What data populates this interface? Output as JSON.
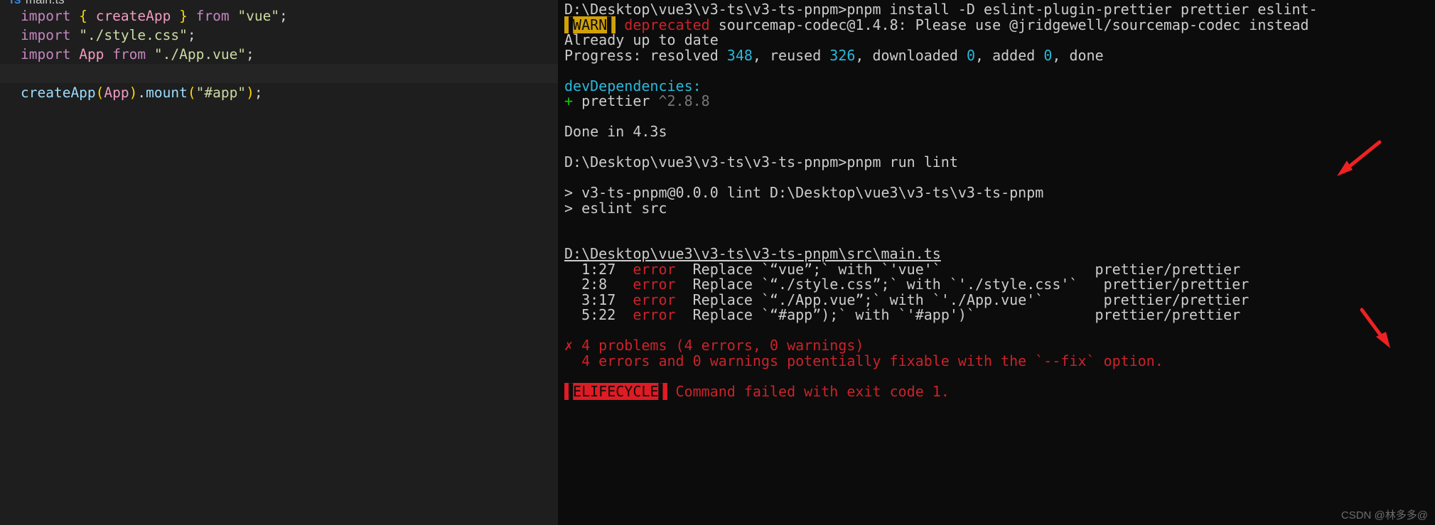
{
  "editor": {
    "tab": {
      "label": "main.ts",
      "icon": "TS",
      "file_type_icon": "typescript-file-icon"
    },
    "code_lines": [
      {
        "tokens": [
          {
            "t": "import",
            "c": "kw-import"
          },
          {
            "t": " ",
            "c": "plain"
          },
          {
            "t": "{",
            "c": "kw-brace"
          },
          {
            "t": " ",
            "c": "plain"
          },
          {
            "t": "createApp",
            "c": "ident-pink"
          },
          {
            "t": " ",
            "c": "plain"
          },
          {
            "t": "}",
            "c": "kw-brace"
          },
          {
            "t": " ",
            "c": "plain"
          },
          {
            "t": "from",
            "c": "kw-import"
          },
          {
            "t": " ",
            "c": "plain"
          },
          {
            "t": "\"vue\"",
            "c": "str"
          },
          {
            "t": ";",
            "c": "punct"
          }
        ]
      },
      {
        "tokens": [
          {
            "t": "import",
            "c": "kw-import"
          },
          {
            "t": " ",
            "c": "plain"
          },
          {
            "t": "\"./style.css\"",
            "c": "str"
          },
          {
            "t": ";",
            "c": "punct"
          }
        ]
      },
      {
        "tokens": [
          {
            "t": "import",
            "c": "kw-import"
          },
          {
            "t": " ",
            "c": "plain"
          },
          {
            "t": "App",
            "c": "ident-pink"
          },
          {
            "t": " ",
            "c": "plain"
          },
          {
            "t": "from",
            "c": "kw-import"
          },
          {
            "t": " ",
            "c": "plain"
          },
          {
            "t": "\"./App.vue\"",
            "c": "str"
          },
          {
            "t": ";",
            "c": "punct"
          }
        ]
      },
      {
        "highlight": true,
        "tokens": []
      },
      {
        "tokens": [
          {
            "t": "createApp",
            "c": "ident-call"
          },
          {
            "t": "(",
            "c": "kw-brace"
          },
          {
            "t": "App",
            "c": "ident-pink"
          },
          {
            "t": ")",
            "c": "kw-brace"
          },
          {
            "t": ".",
            "c": "punct"
          },
          {
            "t": "mount",
            "c": "ident-call"
          },
          {
            "t": "(",
            "c": "kw-brace"
          },
          {
            "t": "\"#app\"",
            "c": "str"
          },
          {
            "t": ")",
            "c": "kw-brace"
          },
          {
            "t": ";",
            "c": "punct"
          }
        ]
      }
    ]
  },
  "terminal": {
    "lines": [
      {
        "segs": [
          {
            "t": "D:\\Desktop\\vue3\\v3-ts\\v3-ts-pnpm>pnpm install -D eslint-plugin-prettier prettier eslint-",
            "c": "c-white"
          }
        ]
      },
      {
        "segs": [
          {
            "t": "▐WARN▌",
            "c": "badge-warn"
          },
          {
            "t": " ",
            "c": "c-white"
          },
          {
            "t": "deprecated",
            "c": "c-red"
          },
          {
            "t": " sourcemap-codec@1.4.8: Please use @jridgewell/sourcemap-codec instead",
            "c": "c-white"
          }
        ]
      },
      {
        "segs": [
          {
            "t": "Already up to date",
            "c": "c-white"
          }
        ]
      },
      {
        "segs": [
          {
            "t": "Progress: resolved ",
            "c": "c-white"
          },
          {
            "t": "348",
            "c": "c-cyan"
          },
          {
            "t": ", reused ",
            "c": "c-white"
          },
          {
            "t": "326",
            "c": "c-cyan"
          },
          {
            "t": ", downloaded ",
            "c": "c-white"
          },
          {
            "t": "0",
            "c": "c-cyan"
          },
          {
            "t": ", added ",
            "c": "c-white"
          },
          {
            "t": "0",
            "c": "c-cyan"
          },
          {
            "t": ", done",
            "c": "c-white"
          }
        ]
      },
      {
        "segs": []
      },
      {
        "segs": [
          {
            "t": "devDependencies:",
            "c": "c-cyan"
          }
        ]
      },
      {
        "segs": [
          {
            "t": "+",
            "c": "c-green"
          },
          {
            "t": " prettier ",
            "c": "c-white"
          },
          {
            "t": "^2.8.8",
            "c": "c-dim"
          }
        ]
      },
      {
        "segs": []
      },
      {
        "segs": [
          {
            "t": "Done in 4.3s",
            "c": "c-white"
          }
        ]
      },
      {
        "segs": []
      },
      {
        "segs": [
          {
            "t": "D:\\Desktop\\vue3\\v3-ts\\v3-ts-pnpm>pnpm run lint",
            "c": "c-white"
          }
        ]
      },
      {
        "segs": []
      },
      {
        "segs": [
          {
            "t": "> v3-ts-pnpm@0.0.0 lint D:\\Desktop\\vue3\\v3-ts\\v3-ts-pnpm",
            "c": "c-white"
          }
        ]
      },
      {
        "segs": [
          {
            "t": "> eslint src",
            "c": "c-white"
          }
        ]
      },
      {
        "segs": []
      },
      {
        "segs": []
      },
      {
        "segs": [
          {
            "t": "D:\\Desktop\\vue3\\v3-ts\\v3-ts-pnpm\\src\\main.ts",
            "c": "c-white c-under"
          }
        ]
      },
      {
        "segs": [
          {
            "t": "  1:27  ",
            "c": "c-white"
          },
          {
            "t": "error",
            "c": "c-red"
          },
          {
            "t": "  Replace `“vue”;` with `'vue'`                  prettier/prettier",
            "c": "c-white"
          }
        ]
      },
      {
        "segs": [
          {
            "t": "  2:8   ",
            "c": "c-white"
          },
          {
            "t": "error",
            "c": "c-red"
          },
          {
            "t": "  Replace `“./style.css”;` with `'./style.css'`   prettier/prettier",
            "c": "c-white"
          }
        ]
      },
      {
        "segs": [
          {
            "t": "  3:17  ",
            "c": "c-white"
          },
          {
            "t": "error",
            "c": "c-red"
          },
          {
            "t": "  Replace `“./App.vue”;` with `'./App.vue'`       prettier/prettier",
            "c": "c-white"
          }
        ]
      },
      {
        "segs": [
          {
            "t": "  5:22  ",
            "c": "c-white"
          },
          {
            "t": "error",
            "c": "c-red"
          },
          {
            "t": "  Replace `“#app”);` with `'#app')`              prettier/prettier",
            "c": "c-white"
          }
        ]
      },
      {
        "segs": []
      },
      {
        "segs": [
          {
            "t": "✗ 4 problems (4 errors, 0 warnings)",
            "c": "c-red"
          }
        ]
      },
      {
        "segs": [
          {
            "t": "  4 errors and 0 warnings potentially fixable with the `--fix` option.",
            "c": "c-red"
          }
        ]
      },
      {
        "segs": []
      },
      {
        "segs": [
          {
            "t": "▐ELIFECYCLE▌",
            "c": "badge-err"
          },
          {
            "t": " Command failed with exit code 1.",
            "c": "c-red"
          }
        ]
      }
    ]
  },
  "annotations": {
    "arrows": [
      {
        "name": "arrow-pointing-to-pnpm-run-lint",
        "color": "#ee2222"
      },
      {
        "name": "arrow-pointing-to-app-vue-replacement",
        "color": "#ee2222"
      }
    ]
  },
  "watermark": {
    "text": "CSDN @林多多@"
  },
  "colors": {
    "editor_bg": "#1e1e1e",
    "terminal_bg": "#0c0c0c",
    "error_red": "#cc2229",
    "warn_yellow": "#d2a106",
    "cyan": "#29b8db",
    "green": "#16c60c",
    "arrow_red": "#ee2222"
  }
}
